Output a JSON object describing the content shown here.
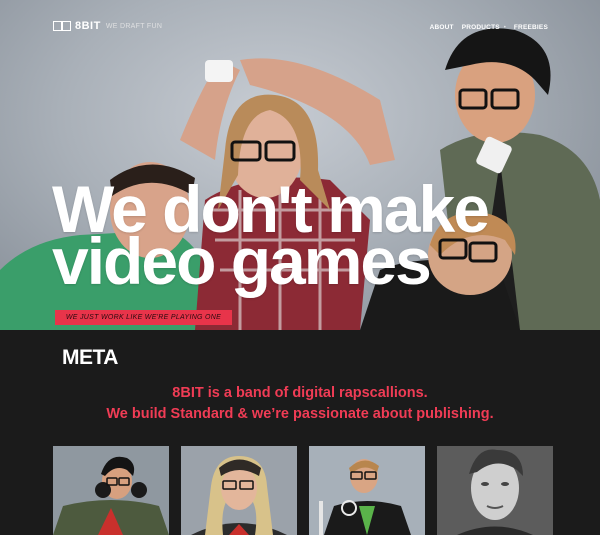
{
  "header": {
    "brand": "8BIT",
    "tagline": "WE DRAFT FUN",
    "nav": [
      {
        "label": "ABOUT"
      },
      {
        "label": "PRODUCTS"
      },
      {
        "label": "FREEBIES"
      }
    ]
  },
  "hero": {
    "headline": "We don't make video games",
    "subline": "WE JUST WORK LIKE WE'RE PLAYING ONE",
    "accent_color": "#e8344a"
  },
  "meta": {
    "title": "META",
    "intro_line1": "8BIT is a band of digital rapscallions.",
    "intro_line2": "We build Standard & we’re passionate about publishing.",
    "accent_color": "#f03c55"
  },
  "team": [
    {
      "name": "team-photo-1"
    },
    {
      "name": "team-photo-2"
    },
    {
      "name": "team-photo-3"
    },
    {
      "name": "team-photo-4"
    }
  ]
}
